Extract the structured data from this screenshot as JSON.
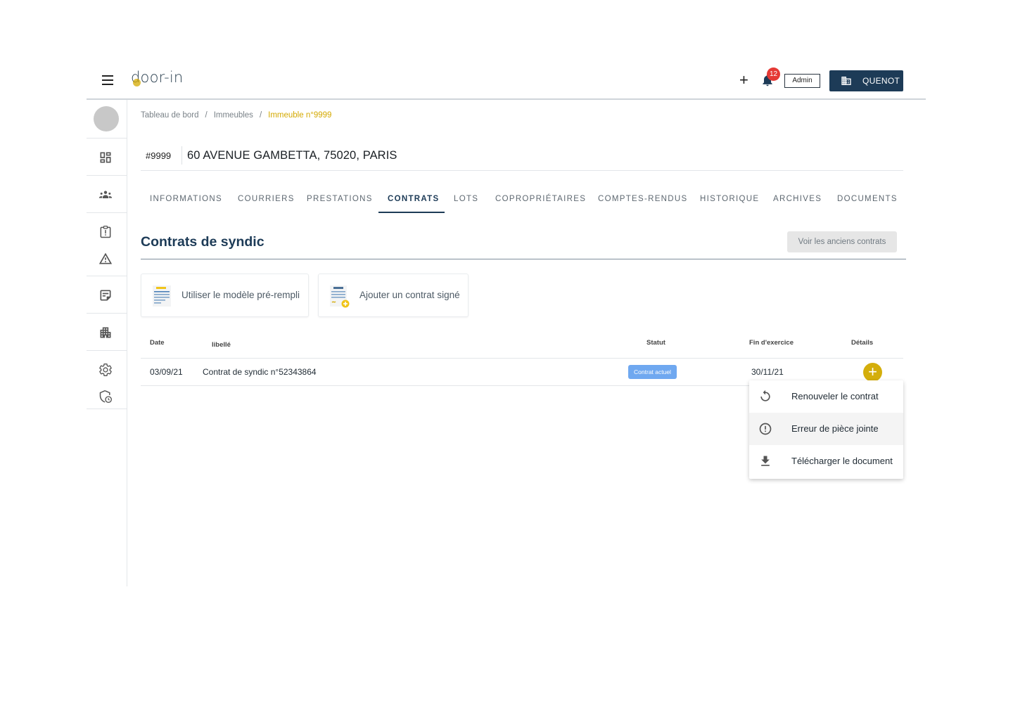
{
  "topbar": {
    "logo": "door-in",
    "notifications_count": "12",
    "admin_label": "Admin",
    "building_label": "QUENOT"
  },
  "breadcrumb": {
    "items": [
      "Tableau de bord",
      "Immeubles",
      "Immeuble n°9999"
    ],
    "separator": "/"
  },
  "building": {
    "id": "#9999",
    "address": "60 AVENUE GAMBETTA, 75020, PARIS"
  },
  "tabs": [
    {
      "label": "INFORMATIONS"
    },
    {
      "label": "COURRIERS"
    },
    {
      "label": "PRESTATIONS"
    },
    {
      "label": "CONTRATS"
    },
    {
      "label": "LOTS"
    },
    {
      "label": "COPROPRIÉTAIRES"
    },
    {
      "label": "COMPTES-RENDUS"
    },
    {
      "label": "HISTORIQUE"
    },
    {
      "label": "ARCHIVES"
    },
    {
      "label": "DOCUMENTS"
    }
  ],
  "active_tab": "CONTRATS",
  "section": {
    "title": "Contrats de syndic",
    "old_contracts_button": "Voir les anciens contrats"
  },
  "actions": {
    "template_label": "Utiliser le modèle pré-rempli",
    "signed_label": "Ajouter un contrat signé"
  },
  "table": {
    "headers": {
      "date": "Date",
      "label": "libellé",
      "status": "Statut",
      "end": "Fin d'exercice",
      "details": "Détails"
    },
    "rows": [
      {
        "date": "03/09/21",
        "label": "Contrat de syndic n°52343864",
        "status": "Contrat actuel",
        "end": "30/11/21"
      }
    ]
  },
  "menu": {
    "items": [
      {
        "label": "Renouveler le contrat",
        "icon": "refresh-icon"
      },
      {
        "label": "Erreur de pièce jointe",
        "icon": "alert-circle-icon"
      },
      {
        "label": "Télécharger le document",
        "icon": "download-icon"
      }
    ]
  },
  "colors": {
    "primary": "#1d3b57",
    "accent": "#d4a900",
    "status": "#6fa8f0",
    "notification": "#e53935"
  }
}
